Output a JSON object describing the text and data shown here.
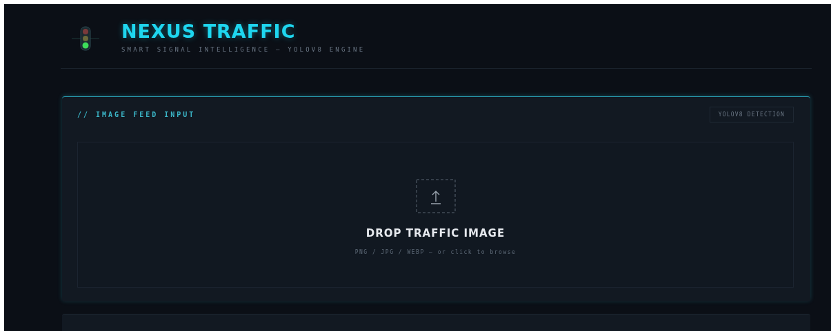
{
  "header": {
    "title": "NEXUS TRAFFIC",
    "subtitle": "SMART SIGNAL INTELLIGENCE — YOLOV8 ENGINE"
  },
  "input_panel": {
    "title": "// IMAGE FEED INPUT",
    "badge": "YOLOV8 DETECTION",
    "dropzone": {
      "title": "DROP TRAFFIC IMAGE",
      "hint": "PNG / JPG / WEBP — or click to browse"
    }
  }
}
